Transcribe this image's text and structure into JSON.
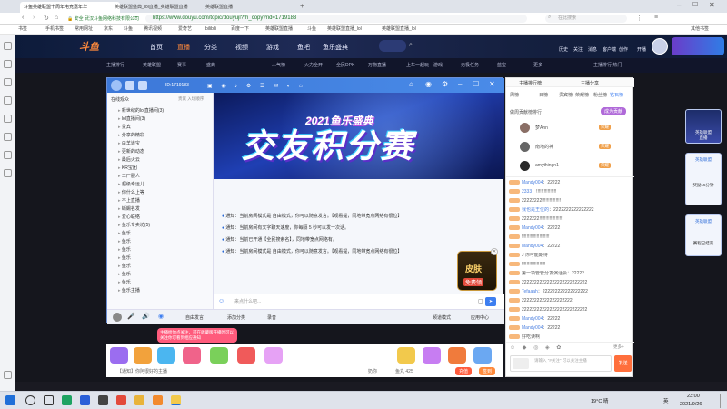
{
  "browser": {
    "tabs": [
      {
        "label": "斗鱼英雄联盟十周年电竞嘉年华",
        "active": true
      },
      {
        "label": "英雄联盟盛典_lol直播_英雄联盟直播",
        "active": false
      },
      {
        "label": "英雄联盟直播",
        "active": false
      }
    ],
    "security_label": "安全",
    "url_owner": "武汉斗鱼网络科技有限公司",
    "url": "https://www.douyu.com/topic/douyujl?rh_copy?rid=1719183",
    "search_placeholder": "在此搜索",
    "bookmarks": [
      "书签",
      "手机书签",
      "常用网址",
      "京东",
      "斗鱼",
      "腾讯视频",
      "爱奇艺",
      "bilibili",
      "百度一下",
      "英雄联盟直播",
      "斗鱼",
      "英雄联盟直播_lol",
      "英雄联盟直播_lol"
    ],
    "bookmarks_right": "其他书签"
  },
  "site": {
    "logo": "斗鱼",
    "nav": [
      {
        "label": "首页",
        "active": false
      },
      {
        "label": "直播",
        "active": true
      },
      {
        "label": "分类",
        "active": false
      },
      {
        "label": "视频",
        "active": false
      },
      {
        "label": "游戏",
        "active": false
      },
      {
        "label": "鱼吧",
        "active": false
      },
      {
        "label": "鱼乐盛典",
        "active": false
      }
    ],
    "header_right": [
      "历史",
      "关注",
      "消息",
      "客户端",
      "创作",
      "开播"
    ],
    "subnav": [
      "主播排行",
      "英雄联盟",
      "赛事",
      "盛典",
      "人气榜",
      "火力全开",
      "全民DPK",
      "万物直播",
      "上车一起玩",
      "游戏",
      "无极任务",
      "蓝宝",
      "更多"
    ],
    "subnav_right": "主播排行 热门"
  },
  "client": {
    "room_id": "ID:1719183",
    "left_header": "在线观众",
    "left_header_right": "贵宾 入场顺序",
    "tree": [
      "新世纪的lol直播间(3)",
      "lol直播间(3)",
      "贵宾",
      "分享的精彩",
      "白羊道宝",
      "更新的动态",
      "最后火云",
      "KR宝团",
      "工厂服人",
      "超级幸运儿",
      "你什么上等",
      "不上直播",
      "蜥蜴名发",
      "爱心联络",
      "鱼乐专卖坊(5)",
      "鱼乐",
      "鱼乐",
      "鱼乐",
      "鱼乐",
      "鱼乐",
      "鱼乐",
      "鱼乐",
      "鱼乐主播"
    ],
    "banner_year": "2021鱼乐盛典",
    "banner_title": "交友积分赛",
    "notices": [
      "通知：当前房间模式是 自由模式，你可以随意发言。【观看提，同地带宽点网络有很位】",
      "通知：当前房间有文字聊天速度，你每隔 5 秒可以发一次话。",
      "通知：当前已开通【全民搜索名】，同地带宽点网络有。",
      "通知：当前房间模式是 自由模式，你可以随意发言。【观看提，同地带宽点网络有很位】"
    ],
    "skin_label": "皮肤",
    "skin_sub": "免费领",
    "input_placeholder": "来点什么吧...",
    "bottom_items": [
      "自由发言",
      "添加分类",
      "录音"
    ],
    "bottom_right": [
      "频道模式",
      "应用中心"
    ]
  },
  "chat": {
    "tabs": [
      "主播排行榜",
      "主播分享"
    ],
    "subtabs": [
      "周榜",
      "日榜",
      "贵宾榜",
      "荣耀榜",
      "粉丝榜",
      "钻石榜"
    ],
    "rank_title": "做周贡献榜排行",
    "rank_button": "成为贡献",
    "ranks": [
      {
        "name": "梦Ann",
        "badge": "荣耀"
      },
      {
        "name": "南地的神",
        "badge": "荣耀"
      },
      {
        "name": "amythingn1",
        "badge": "荣耀"
      }
    ],
    "messages": [
      {
        "user": "Mandy004",
        "text": "22222"
      },
      {
        "user": "2333",
        "text": "!!!!!!!!!!!!!!!!"
      },
      {
        "user": "",
        "text": "22222222!!!!!!!!!!!!!!!"
      },
      {
        "user": "我也是王位的",
        "text": "2222222222222222"
      },
      {
        "user": "",
        "text": "2222222!!!!!!!!!!!!!!!!!!"
      },
      {
        "user": "Mandy004",
        "text": "22222"
      },
      {
        "user": "",
        "text": "!!!!!!!!!!!!!!!!!!!!!!"
      },
      {
        "user": "Mandy004",
        "text": "22222"
      },
      {
        "user": "",
        "text": "J 你可能期待"
      },
      {
        "user": "",
        "text": "!!!!!!!!!!!!!!!!!!!"
      },
      {
        "user": "",
        "text": "第一项管管分发演话会：22222"
      },
      {
        "user": "",
        "text": "22222222222222222222222222"
      },
      {
        "user": "Tefaaah",
        "text": "222222222222222222"
      },
      {
        "user": "",
        "text": "22222222222222222222"
      },
      {
        "user": "",
        "text": "22222222222222222222222222"
      },
      {
        "user": "Mandy004",
        "text": "22222"
      },
      {
        "user": "Mandy004",
        "text": "22222"
      },
      {
        "user": "",
        "text": "好吃读啊"
      }
    ],
    "input_placeholder": "请输入 \"#关注\" 可以关注主播",
    "send_label": "发送",
    "more_label": "更多>"
  },
  "gift_tip": "主播给你点关注，可在收藏版开播时可以关注你可看到相应通知",
  "gift_bar_text": "【通知】你阿很好的主播",
  "gift_right": [
    "奶你",
    "鱼丸 425",
    "充值",
    "签到"
  ],
  "promo": [
    {
      "title": "英雄联盟",
      "sub": "直播"
    },
    {
      "title": "英雄联盟",
      "sub": "奖励15分钟"
    },
    {
      "title": "英雄联盟",
      "sub": "赛程已结束"
    }
  ],
  "taskbar": {
    "weather": "19°C 晴",
    "time": "23:00",
    "date": "2021/9/26",
    "lang": "英"
  },
  "colors": {
    "accent": "#3d7ef0",
    "douyu_orange": "#ff8a3c",
    "tip_pink": "#ff5b7c"
  }
}
